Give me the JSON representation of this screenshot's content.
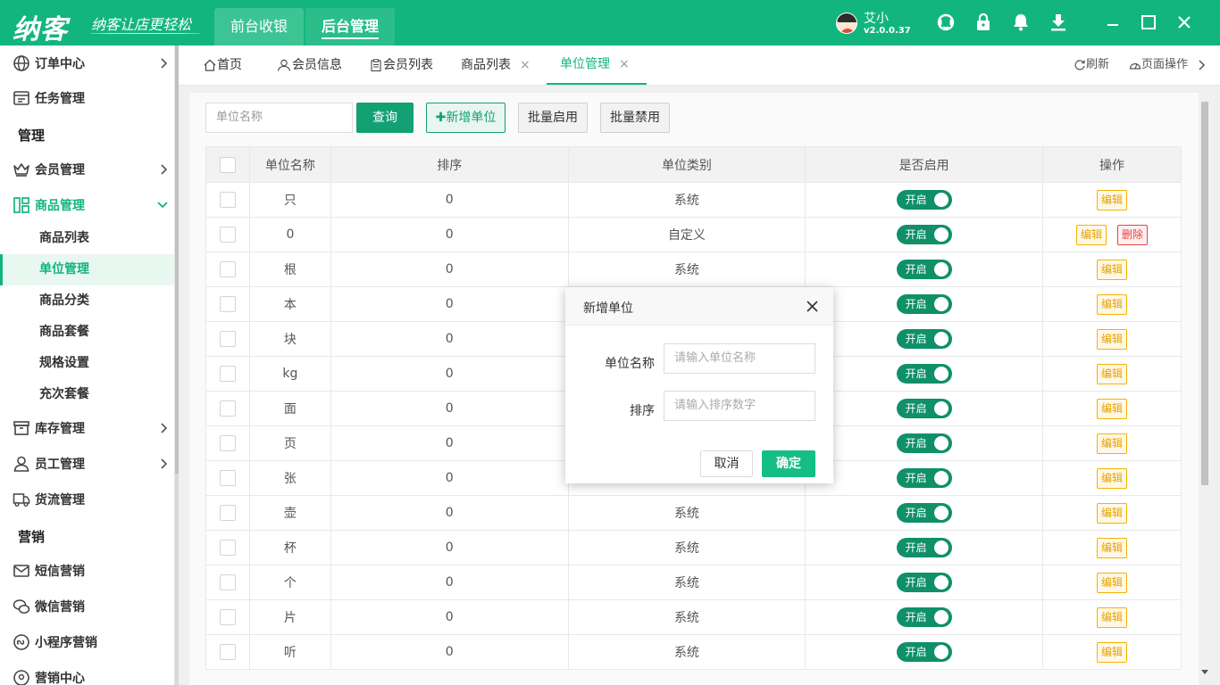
{
  "brand": {
    "logo": "纳客",
    "slogan": "纳客让店更轻松"
  },
  "mode_tabs": {
    "front": "前台收银",
    "back": "后台管理"
  },
  "user": {
    "name": "艾小",
    "version": "v2.0.0.37"
  },
  "sidebar": {
    "items": [
      {
        "label": "订单中心"
      },
      {
        "label": "任务管理"
      },
      {
        "label": "会员管理"
      },
      {
        "label": "商品管理"
      },
      {
        "label": "库存管理"
      },
      {
        "label": "员工管理"
      },
      {
        "label": "货流管理"
      },
      {
        "label": "短信营销"
      },
      {
        "label": "微信营销"
      },
      {
        "label": "小程序营销"
      },
      {
        "label": "营销中心"
      }
    ],
    "headers": {
      "manage": "管理",
      "marketing": "营销"
    },
    "sub_items": [
      "商品列表",
      "单位管理",
      "商品分类",
      "商品套餐",
      "规格设置",
      "充次套餐"
    ]
  },
  "tabs": {
    "home": "首页",
    "member_info": "会员信息",
    "member_list": "会员列表",
    "product_list": "商品列表",
    "unit_manage": "单位管理",
    "close": "×",
    "refresh": "刷新",
    "page_ops": "页面操作"
  },
  "toolbar": {
    "search_placeholder": "单位名称",
    "query": "查询",
    "add": "新增单位",
    "bulk_enable": "批量启用",
    "bulk_disable": "批量禁用"
  },
  "table": {
    "headers": [
      "单位名称",
      "排序",
      "单位类别",
      "是否启用",
      "操作"
    ],
    "switch_label": "开启",
    "edit_label": "编辑",
    "delete_label": "删除",
    "rows": [
      {
        "name": "只",
        "sort": "0",
        "type": "系统"
      },
      {
        "name": "0",
        "sort": "0",
        "type": "自定义"
      },
      {
        "name": "根",
        "sort": "0",
        "type": "系统"
      },
      {
        "name": "本",
        "sort": "0",
        "type": ""
      },
      {
        "name": "块",
        "sort": "0",
        "type": ""
      },
      {
        "name": "kg",
        "sort": "0",
        "type": ""
      },
      {
        "name": "面",
        "sort": "0",
        "type": ""
      },
      {
        "name": "页",
        "sort": "0",
        "type": ""
      },
      {
        "name": "张",
        "sort": "0",
        "type": ""
      },
      {
        "name": "壶",
        "sort": "0",
        "type": "系统"
      },
      {
        "name": "杯",
        "sort": "0",
        "type": "系统"
      },
      {
        "name": "个",
        "sort": "0",
        "type": "系统"
      },
      {
        "name": "片",
        "sort": "0",
        "type": "系统"
      },
      {
        "name": "听",
        "sort": "0",
        "type": "系统"
      }
    ]
  },
  "modal": {
    "title": "新增单位",
    "name_label": "单位名称",
    "name_placeholder": "请输入单位名称",
    "sort_label": "排序",
    "sort_placeholder": "请输入排序数字",
    "cancel": "取消",
    "confirm": "确定"
  },
  "colors": {
    "brand": "#13b57e",
    "switch": "#109068",
    "edit": "#f5b200",
    "delete": "#e64444"
  }
}
